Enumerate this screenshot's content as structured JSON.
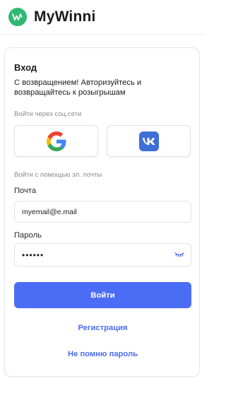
{
  "header": {
    "app_name": "MyWinni"
  },
  "login": {
    "title": "Вход",
    "subtitle": "С возвращением! Авторизуйтесь и возвращайтесь к розыгрышам",
    "social_label": "Войти через соц.сети",
    "email_section_label": "Войти с помощью эл. почты",
    "email_label": "Почта",
    "email_value": "myemail@e.mail",
    "password_label": "Пароль",
    "password_value": "123456",
    "submit_label": "Войти",
    "register_link": "Регистрация",
    "forgot_link": "Не помню пароль"
  },
  "icons": {
    "logo": "mywinni-logo-icon",
    "google": "google-icon",
    "vk": "vk-icon",
    "eye": "eye-closed-icon"
  },
  "colors": {
    "accent": "#4b6cf5",
    "logo_green": "#2fb872",
    "vk_blue": "#3d6fd6"
  }
}
